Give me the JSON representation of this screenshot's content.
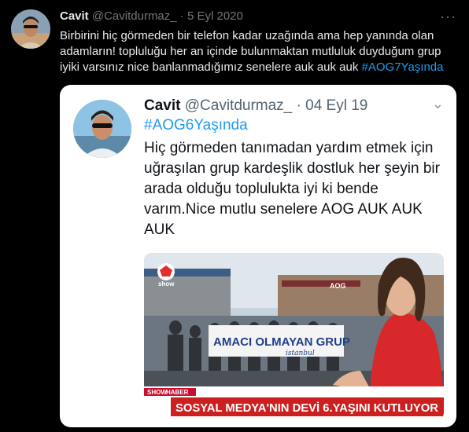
{
  "tweet": {
    "name": "Cavit",
    "handle": "@Cavitdurmaz_",
    "separator": "·",
    "date": "5 Eyl 2020",
    "more_icon": "more-horizontal-icon",
    "text": "Birbirini hiç görmeden bir telefon kadar uzağında ama hep yanında olan adamların! topluluğu her an içinde bulunmaktan mutluluk duyduğum grup iyiki varsınız nice banlanmadığımız senelere auk auk auk ",
    "hashtag": "#AOG7Yaşında",
    "colors": {
      "accent": "#1d9bf0",
      "text": "#e7e9ea",
      "muted": "#71767b",
      "background": "#000000"
    }
  },
  "card": {
    "name": "Cavit",
    "handle": "@Cavitdurmaz_",
    "separator": "·",
    "date": "04 Eyl 19",
    "chevron_icon": "chevron-down-icon",
    "hashtag": "#AOG6Yaşında",
    "text": "Hiç görmeden tanımadan yardım etmek için uğraşılan grup kardeşlik dostluk her şeyin bir arada olduğu toplulukta iyi ki bende varım.Nice mutlu senelere AOG AUK AUK AUK",
    "news": {
      "channel_logo": "show",
      "banner": "AMACI OLMAYAN GRUP",
      "banner_city": "istanbul",
      "building_sign": "AOG",
      "ticker_tag_1": "SHOW",
      "ticker_tag_2": "HABER",
      "headline": "SOSYAL MEDYA'NIN DEVİ 6.YAŞINI KUTLUYOR"
    }
  }
}
